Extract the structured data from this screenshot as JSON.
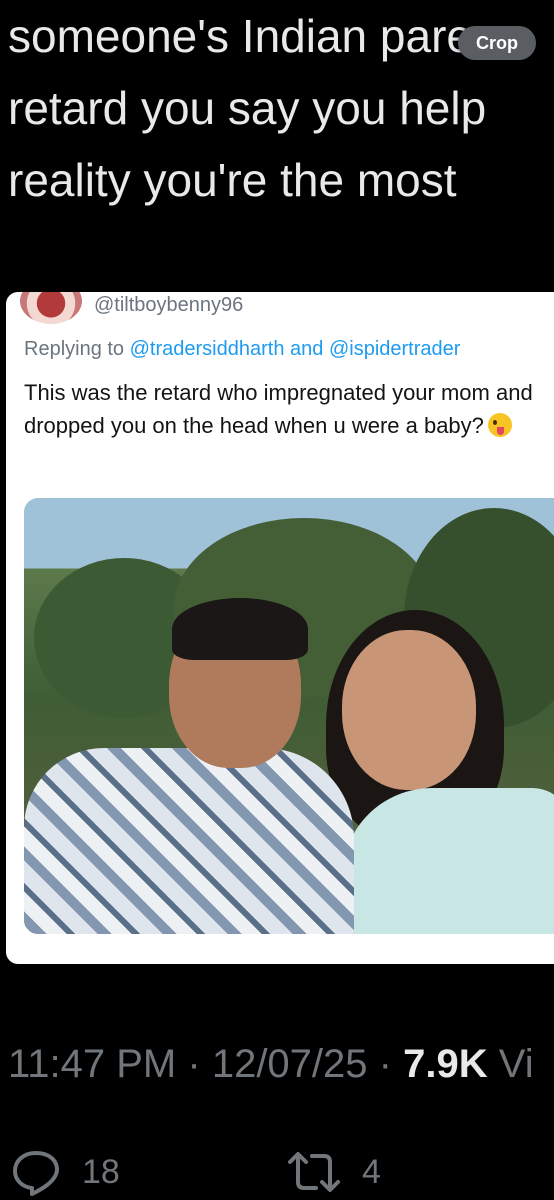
{
  "tweet": {
    "lines": [
      "someone's Indian pare",
      "retard you say you help",
      "reality you're the most"
    ]
  },
  "crop_button": {
    "label": "Crop"
  },
  "quoted": {
    "handle": "@tiltboybenny96",
    "replying_prefix": "Replying to",
    "mention_1": "@tradersiddharth",
    "connector": "and",
    "mention_2": "@ispidertrader",
    "body": "This was the retard who impregnated your mom and dropped you on the head when u were a baby?",
    "emoji_icon": "zany-face-icon"
  },
  "meta": {
    "time": "11:47 PM",
    "sep": "·",
    "date": "12/07/25",
    "views_count": "7.9K",
    "views_label": "Vi"
  },
  "actions": {
    "replies": "18",
    "reposts": "4",
    "reply_icon": "speech-bubble-icon",
    "repost_icon": "repost-arrows-icon"
  },
  "colors": {
    "background": "#000000",
    "text": "#e7e9ea",
    "muted": "#71767b",
    "link": "#1d9bf0"
  }
}
